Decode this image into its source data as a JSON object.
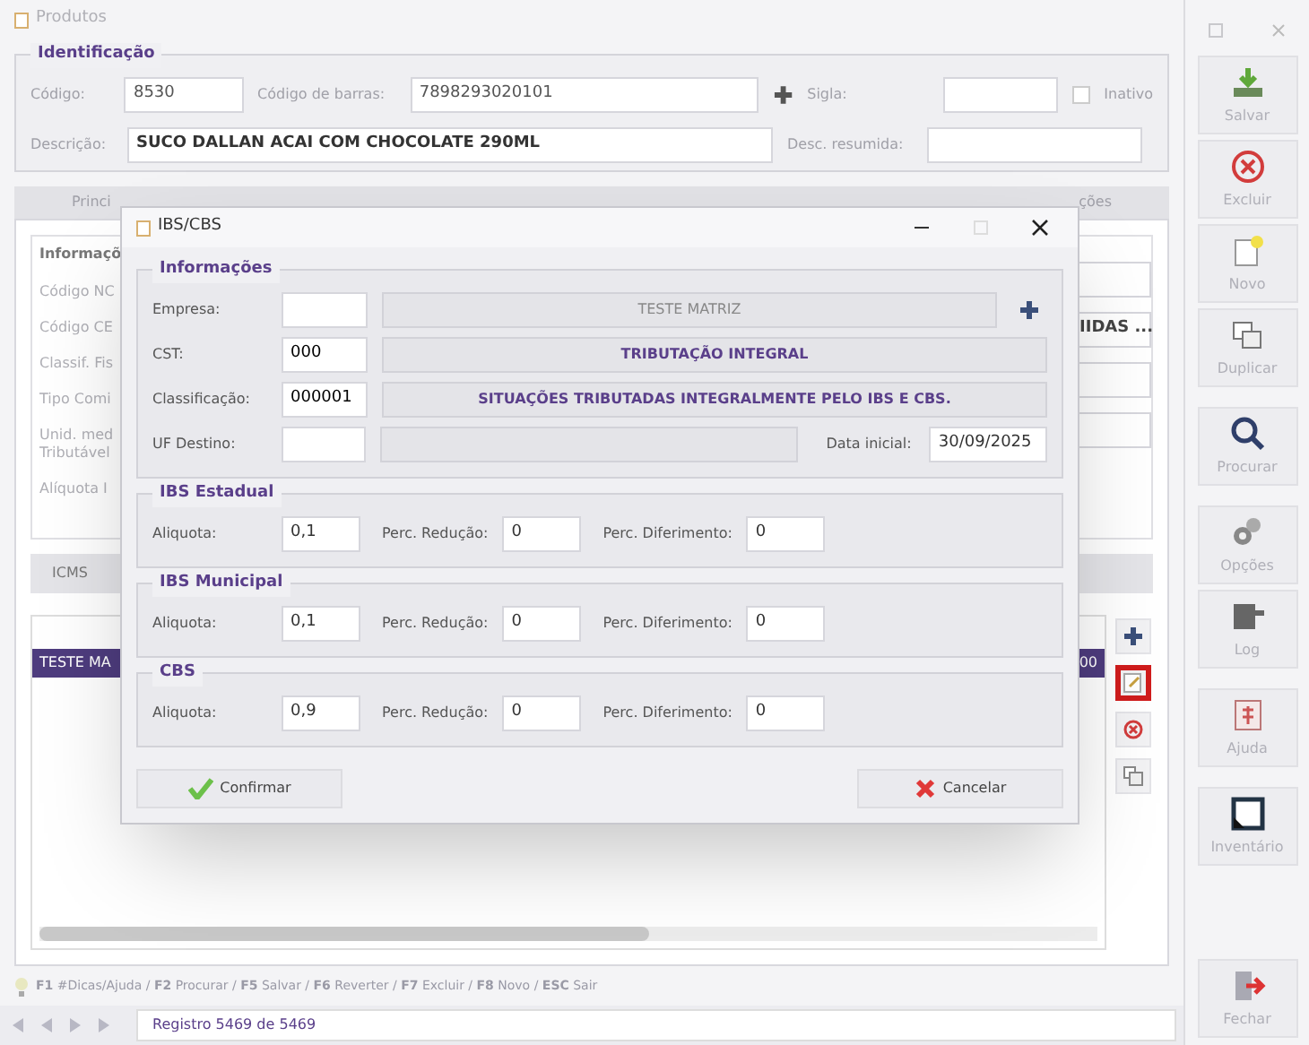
{
  "window": {
    "title": "Produtos"
  },
  "identificacao": {
    "title": "Identificação",
    "codigo_label": "Código:",
    "codigo": "8530",
    "barras_label": "Código de barras:",
    "barras": "7898293020101",
    "sigla_label": "Sigla:",
    "inativo": {
      "label": "Inativo",
      "checked": false
    },
    "descricao_label": "Descrição:",
    "descricao": "SUCO DALLAN ACAI COM CHOCOLATE 290ML",
    "resumida_label": "Desc. resumida:"
  },
  "tabs": [
    {
      "label": "Princi",
      "selected": false
    },
    {
      "label": "ções",
      "selected": false
    }
  ],
  "info_group": {
    "title": "Informaçõ",
    "labels": [
      "Código NC",
      "Código CE",
      "Classif. Fis",
      "Tipo Comi",
      "Unid. med\nTributável",
      "Alíquota I"
    ],
    "fields": [
      {
        "kind": "blank"
      },
      {
        "kind": "text",
        "value": "IIDAS ..."
      },
      {
        "kind": "blank"
      },
      {
        "kind": "blank"
      }
    ]
  },
  "sub_tabs": [
    {
      "label": "ICMS",
      "selected": true
    }
  ],
  "grid": {
    "rows": [
      {
        "cells": [
          "TESTE MA",
          "00"
        ],
        "selected": true
      }
    ]
  },
  "side_buttons": [
    {
      "kind": "add",
      "highlighted": false
    },
    {
      "kind": "edit",
      "highlighted": true
    },
    {
      "kind": "delete",
      "highlighted": false
    },
    {
      "kind": "duplicate",
      "highlighted": false
    }
  ],
  "hint": "**F1** #Dicas/Ajuda / **F2** Procurar / **F5** Salvar / **F6** Reverter / **F7** Excluir / **F8** Novo / **ESC** Sair",
  "status": "Registro 5469 de 5469",
  "toolbar": [
    {
      "kind": "save",
      "label": "Salvar"
    },
    {
      "kind": "delete",
      "label": "Excluir"
    },
    {
      "kind": "new",
      "label": "Novo"
    },
    {
      "kind": "duplicate",
      "label": "Duplicar"
    },
    {
      "kind": "search",
      "label": "Procurar"
    },
    {
      "kind": "options",
      "label": "Opções"
    },
    {
      "kind": "log",
      "label": "Log"
    },
    {
      "kind": "help",
      "label": "Ajuda"
    },
    {
      "kind": "inventory",
      "label": "Inventário"
    },
    {
      "kind": "close",
      "label": "Fechar"
    }
  ],
  "dialog": {
    "title": "IBS/CBS",
    "info": {
      "title": "Informações",
      "rows": [
        {
          "label": "Empresa:",
          "code": "",
          "description": "TESTE MATRIZ",
          "bold": false
        },
        {
          "label": "CST:",
          "code": "000",
          "description": "TRIBUTAÇÃO INTEGRAL",
          "bold": true
        },
        {
          "label": "Classificação:",
          "code": "000001",
          "description": "SITUAÇÕES TRIBUTADAS INTEGRALMENTE PELO IBS E CBS.",
          "bold": true
        },
        {
          "label": "UF Destino:"
        }
      ],
      "date_label": "Data inicial:",
      "date": "30/09/2025"
    },
    "groups": [
      {
        "title": "IBS Estadual",
        "aliquota_label": "Aliquota:",
        "aliquota": "0,1",
        "reducao_label": "Perc. Redução:",
        "reducao": "0",
        "diferimento_label": "Perc. Diferimento:",
        "diferimento": "0"
      },
      {
        "title": "IBS Municipal",
        "aliquota_label": "Aliquota:",
        "aliquota": "0,1",
        "reducao_label": "Perc. Redução:",
        "reducao": "0",
        "diferimento_label": "Perc. Diferimento:",
        "diferimento": "0"
      },
      {
        "title": "CBS",
        "aliquota_label": "Aliquota:",
        "aliquota": "0,9",
        "reducao_label": "Perc. Redução:",
        "reducao": "0",
        "diferimento_label": "Perc. Diferimento:",
        "diferimento": "0"
      }
    ],
    "confirm": "Confirmar",
    "cancel": "Cancelar"
  }
}
